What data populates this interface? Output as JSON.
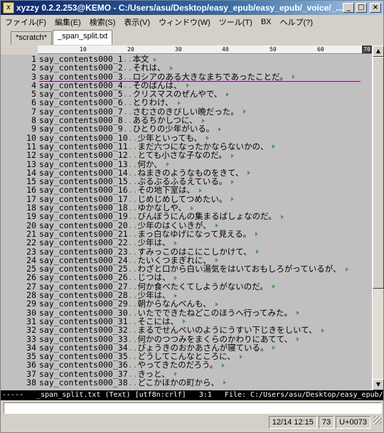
{
  "window": {
    "title": "xyzzy 0.2.2.253@KEMO - C:/Users/asu/Desktop/easy_epub/easy_epub/_voice/_...",
    "icon": "xyzzy-app-icon",
    "controls": {
      "minimize": "_",
      "maximize": "□",
      "close": "×"
    }
  },
  "menu": [
    "ファイル(F)",
    "編集(E)",
    "検索(S)",
    "表示(V)",
    "ウィンドウ(W)",
    "ツール(T)",
    "BX",
    "ヘルプ(?)"
  ],
  "tabs": [
    {
      "label": "*scratch*",
      "active": false
    },
    {
      "label": "_span_split.txt",
      "active": true
    }
  ],
  "ruler": {
    "marks": [
      "10",
      "20",
      "30",
      "40",
      "50",
      "60"
    ],
    "current": "70"
  },
  "editor": {
    "lines": [
      {
        "num": "1",
        "key": "say_contents000_1",
        "text": "本文"
      },
      {
        "num": "2",
        "key": "say_contents000_2",
        "text": "それは、"
      },
      {
        "num": "3",
        "key": "say_contents000_3",
        "text": "ロシアのある大きなまちであったことだ。"
      },
      {
        "num": "4",
        "key": "say_contents000_4",
        "text": "そのばんは、"
      },
      {
        "num": "5",
        "key": "say_contents000_5",
        "text": "クリスマスのぜんやで、"
      },
      {
        "num": "6",
        "key": "say_contents000_6",
        "text": "とりわけ、"
      },
      {
        "num": "7",
        "key": "say_contents000_7",
        "text": "さむさのきびしい晩だった。"
      },
      {
        "num": "8",
        "key": "say_contents000_8",
        "text": "あるちかしつに、"
      },
      {
        "num": "9",
        "key": "say_contents000_9",
        "text": "ひとりの少年がいる。"
      },
      {
        "num": "10",
        "key": "say_contents000_10",
        "text": "少年といっても、"
      },
      {
        "num": "11",
        "key": "say_contents000_11",
        "text": "まだ六つになったかならないかの、"
      },
      {
        "num": "12",
        "key": "say_contents000_12",
        "text": "とても小さな子なのだ。"
      },
      {
        "num": "13",
        "key": "say_contents000_13",
        "text": "何か、"
      },
      {
        "num": "14",
        "key": "say_contents000_14",
        "text": "ねまきのようなものをきて、"
      },
      {
        "num": "15",
        "key": "say_contents000_15",
        "text": "ぶるぶるふるえている。"
      },
      {
        "num": "16",
        "key": "say_contents000_16",
        "text": "その地下室は、"
      },
      {
        "num": "17",
        "key": "say_contents000_17",
        "text": "じめじめしてつめたい。"
      },
      {
        "num": "18",
        "key": "say_contents000_18",
        "text": "ゆかなしや、"
      },
      {
        "num": "19",
        "key": "say_contents000_19",
        "text": "びんぼうにんの集まるばしょなのだ。"
      },
      {
        "num": "20",
        "key": "say_contents000_20",
        "text": "少年のはくいきが、"
      },
      {
        "num": "21",
        "key": "say_contents000_21",
        "text": "まっ白なゆげになって見える。"
      },
      {
        "num": "22",
        "key": "say_contents000_22",
        "text": "少年は、"
      },
      {
        "num": "23",
        "key": "say_contents000_23",
        "text": "すみっこのはこにこしかけて、"
      },
      {
        "num": "24",
        "key": "say_contents000_24",
        "text": "たいくつまぎれに、"
      },
      {
        "num": "25",
        "key": "say_contents000_25",
        "text": "わざと口から白い湯気をはいておもしろがっているが、"
      },
      {
        "num": "26",
        "key": "say_contents000_26",
        "text": "じつは、"
      },
      {
        "num": "27",
        "key": "say_contents000_27",
        "text": "何か食べたくてしようがないのだ。"
      },
      {
        "num": "28",
        "key": "say_contents000_28",
        "text": "少年は、"
      },
      {
        "num": "29",
        "key": "say_contents000_29",
        "text": "朝からなんべんも、"
      },
      {
        "num": "30",
        "key": "say_contents000_30",
        "text": "いたでできたねどこのほうへ行ってみた。"
      },
      {
        "num": "31",
        "key": "say_contents000_31",
        "text": "そこには、"
      },
      {
        "num": "32",
        "key": "say_contents000_32",
        "text": "まるでせんべいのようにうすい下じきをしいて、"
      },
      {
        "num": "33",
        "key": "say_contents000_33",
        "text": "何かのつつみをまくらのかわりにあてて、"
      },
      {
        "num": "34",
        "key": "say_contents000_34",
        "text": "びょうきのおかあさんが寝ている。"
      },
      {
        "num": "35",
        "key": "say_contents000_35",
        "text": "どうしてこんなところに、"
      },
      {
        "num": "36",
        "key": "say_contents000_36",
        "text": "やってきたのだろう。"
      },
      {
        "num": "37",
        "key": "say_contents000_37",
        "text": "きっと、"
      },
      {
        "num": "38",
        "key": "say_contents000_38",
        "text": "どこかほかの町から、"
      }
    ]
  },
  "modeline": {
    "prefix": "-----",
    "buffer": "_span_split.txt (Text) [utf8n:crlf]",
    "position": "3:1",
    "file": "File: C:/Users/asu/Desktop/easy_epub/easy_epub/"
  },
  "statusbar": {
    "datetime": "12/14 12:15",
    "column": "73",
    "char": "U+0073"
  },
  "colors": {
    "titlebar": "#0a246a",
    "editor_bg": "#c0c0c0",
    "eol_mark": "#40a040",
    "cursor_line": "#800080"
  }
}
